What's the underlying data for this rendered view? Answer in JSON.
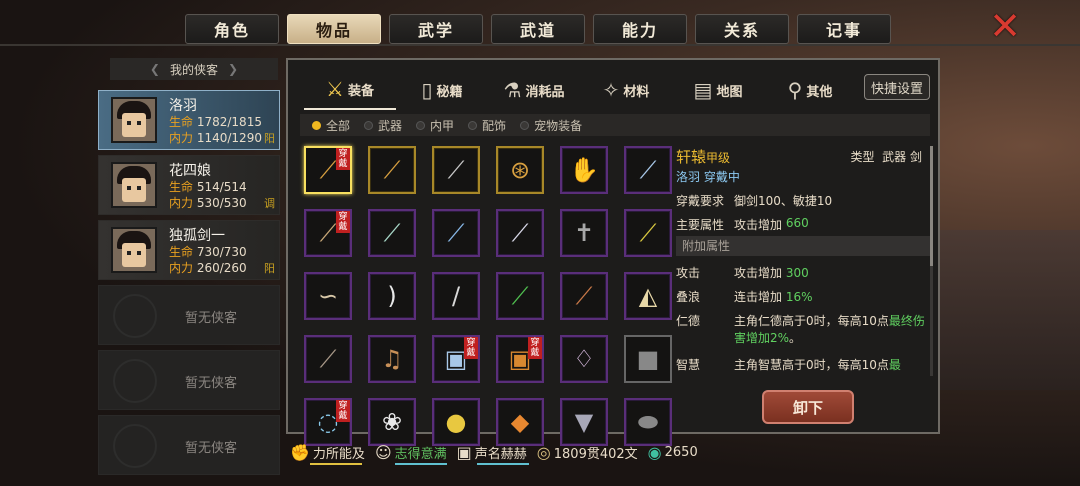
{
  "tabs": [
    "角色",
    "物品",
    "武学",
    "武道",
    "能力",
    "关系",
    "记事"
  ],
  "active_tab": 1,
  "close_glyph": "✕",
  "left_header": "我的侠客",
  "characters": [
    {
      "name": "洛羽",
      "hp_label": "生命",
      "hp": "1782/1815",
      "mp_label": "内力",
      "mp": "1140/1290",
      "tag": "阳",
      "selected": true
    },
    {
      "name": "花四娘",
      "hp_label": "生命",
      "hp": "514/514",
      "mp_label": "内力",
      "mp": "530/530",
      "tag": "调",
      "selected": false
    },
    {
      "name": "独孤剑一",
      "hp_label": "生命",
      "hp": "730/730",
      "mp_label": "内力",
      "mp": "260/260",
      "tag": "阳",
      "selected": false
    }
  ],
  "empty_slot_label": "暂无侠客",
  "category_tabs": [
    {
      "label": "装备",
      "icon": "equipment-icon",
      "glyph": "⚔"
    },
    {
      "label": "秘籍",
      "icon": "book-icon",
      "glyph": "▯"
    },
    {
      "label": "消耗品",
      "icon": "potion-icon",
      "glyph": "⚗"
    },
    {
      "label": "材料",
      "icon": "material-icon",
      "glyph": "✧"
    },
    {
      "label": "地图",
      "icon": "map-icon",
      "glyph": "▤"
    },
    {
      "label": "其他",
      "icon": "other-icon",
      "glyph": "⚲"
    }
  ],
  "quick_settings": "快捷设置",
  "filters": [
    {
      "label": "全部",
      "on": true
    },
    {
      "label": "武器",
      "on": false
    },
    {
      "label": "内甲",
      "on": false
    },
    {
      "label": "配饰",
      "on": false
    },
    {
      "label": "宠物装备",
      "on": false
    }
  ],
  "worn_label": "穿戴",
  "items": [
    {
      "name": "sword-icon",
      "glyph": "⟋",
      "color": "#d8a040",
      "frame": "sel",
      "worn": true
    },
    {
      "name": "sword-icon",
      "glyph": "⟋",
      "color": "#d8a040",
      "frame": "gold",
      "worn": false
    },
    {
      "name": "sword-icon",
      "glyph": "⟋",
      "color": "#c8c8c8",
      "frame": "gold",
      "worn": false
    },
    {
      "name": "shield-icon",
      "glyph": "⊛",
      "color": "#d8a040",
      "frame": "gold",
      "worn": false
    },
    {
      "name": "glove-icon",
      "glyph": "✋",
      "color": "#c89040",
      "frame": "purple",
      "worn": false
    },
    {
      "name": "sword-icon",
      "glyph": "⟋",
      "color": "#a8c8e8",
      "frame": "purple",
      "worn": false
    },
    {
      "name": "sword-icon",
      "glyph": "⟋",
      "color": "#c8a878",
      "frame": "purple",
      "worn": true
    },
    {
      "name": "sword-icon",
      "glyph": "⟋",
      "color": "#a8d8c8",
      "frame": "purple",
      "worn": false
    },
    {
      "name": "sword-icon",
      "glyph": "⟋",
      "color": "#88b8e8",
      "frame": "purple",
      "worn": false
    },
    {
      "name": "sword-icon",
      "glyph": "⟋",
      "color": "#d8d8e8",
      "frame": "purple",
      "worn": false
    },
    {
      "name": "sword-icon",
      "glyph": "✝",
      "color": "#a8a8a8",
      "frame": "purple",
      "worn": false
    },
    {
      "name": "blade-icon",
      "glyph": "⟋",
      "color": "#d8c840",
      "frame": "purple",
      "worn": false
    },
    {
      "name": "whip-icon",
      "glyph": "∽",
      "color": "#d8c8a8",
      "frame": "purple",
      "worn": false
    },
    {
      "name": "blade-icon",
      "glyph": ")",
      "color": "#e8e8e8",
      "frame": "purple",
      "worn": false
    },
    {
      "name": "blade-icon",
      "glyph": "/",
      "color": "#d8d8d8",
      "frame": "purple",
      "worn": false
    },
    {
      "name": "blade-icon",
      "glyph": "⟋",
      "color": "#50c050",
      "frame": "purple",
      "worn": false
    },
    {
      "name": "spear-icon",
      "glyph": "⟋",
      "color": "#c87848",
      "frame": "purple",
      "worn": false
    },
    {
      "name": "fan-icon",
      "glyph": "◭",
      "color": "#e8d8a8",
      "frame": "purple",
      "worn": false
    },
    {
      "name": "staff-icon",
      "glyph": "⟋",
      "color": "#a89888",
      "frame": "purple",
      "worn": false
    },
    {
      "name": "pipa-icon",
      "glyph": "♫",
      "color": "#c89058",
      "frame": "purple",
      "worn": false
    },
    {
      "name": "armor-icon",
      "glyph": "▣",
      "color": "#a8c8e8",
      "frame": "purple",
      "worn": true
    },
    {
      "name": "armor-icon",
      "glyph": "▣",
      "color": "#d88830",
      "frame": "purple",
      "worn": true
    },
    {
      "name": "robe-icon",
      "glyph": "♢",
      "color": "#e8c8f0",
      "frame": "purple",
      "worn": false
    },
    {
      "name": "cloth-icon",
      "glyph": "■",
      "color": "#888888",
      "frame": "grey",
      "worn": false
    },
    {
      "name": "ring-icon",
      "glyph": "◌",
      "color": "#88c8e8",
      "frame": "purple",
      "worn": true
    },
    {
      "name": "flower-icon",
      "glyph": "❀",
      "color": "#e8e8e8",
      "frame": "purple",
      "worn": false
    },
    {
      "name": "pouch-icon",
      "glyph": "●",
      "color": "#e8c840",
      "frame": "purple",
      "worn": false
    },
    {
      "name": "token-icon",
      "glyph": "◆",
      "color": "#e88830",
      "frame": "purple",
      "worn": false
    },
    {
      "name": "vest-icon",
      "glyph": "▼",
      "color": "#a8a8b8",
      "frame": "purple",
      "worn": false
    },
    {
      "name": "stone-icon",
      "glyph": "⬬",
      "color": "#888888",
      "frame": "purple",
      "worn": false
    }
  ],
  "detail": {
    "name": "轩辕",
    "grade": "甲级",
    "type_label": "类型",
    "type_value": "武器 剑",
    "wearer": "洛羽 穿戴中",
    "req_label": "穿戴要求",
    "req_value": "御剑100、敏捷10",
    "main_label": "主要属性",
    "main_value": "攻击增加",
    "main_num": "660",
    "extra_header": "附加属性",
    "extras": [
      {
        "k": "攻击",
        "v": "攻击增加 ",
        "num": "300",
        "rest": ""
      },
      {
        "k": "叠浪",
        "v": "连击增加 ",
        "num": "16%",
        "rest": ""
      },
      {
        "k": "仁德",
        "v": "主角仁德高于0时，每高10点",
        "num": "最终伤害增加2%",
        "rest": "。"
      },
      {
        "k": "智慧",
        "v": "主角智慧高于0时，每高10点",
        "num": "最",
        "rest": ""
      }
    ]
  },
  "unequip_label": "卸下",
  "status": {
    "s1": "力所能及",
    "s2": "志得意满",
    "s3": "声名赫赫",
    "money": "1809贯402文",
    "gems": "2650"
  },
  "colors": {
    "accent": "#e8b830",
    "green": "#60d060",
    "purple_frame": "#5a2e7a",
    "selected_char": "#4a6c84"
  }
}
